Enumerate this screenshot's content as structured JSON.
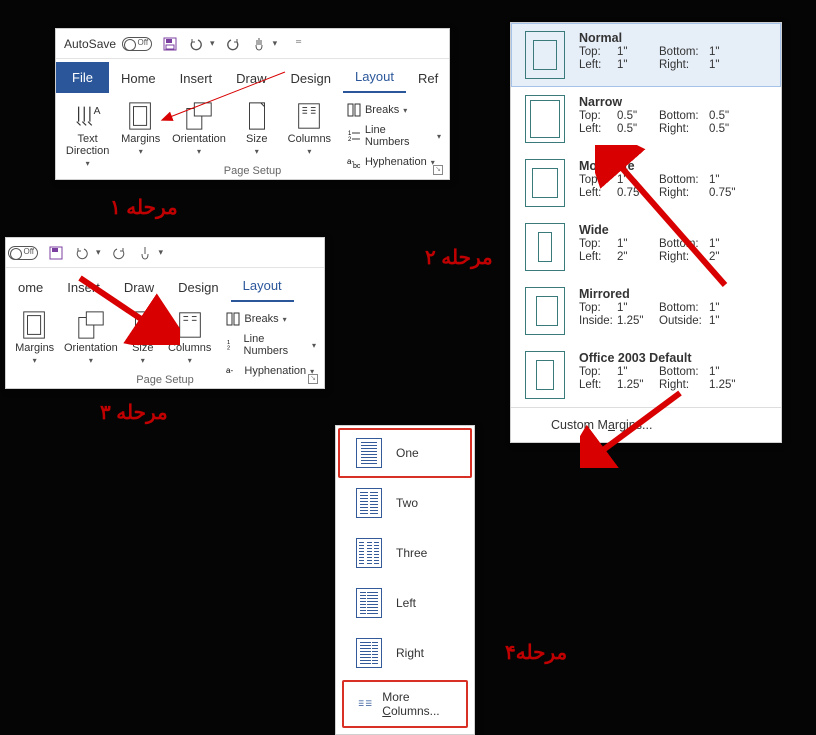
{
  "steps": {
    "s1": "مرحله ۱",
    "s2": "مرحله ۲",
    "s3": "مرحله ۳",
    "s4": "مرحله۴"
  },
  "title": {
    "autosave": "AutoSave"
  },
  "tabs": {
    "file": "File",
    "home": "Home",
    "insert": "Insert",
    "draw": "Draw",
    "design": "Design",
    "layout": "Layout",
    "ref": "Ref"
  },
  "ribbon": {
    "text_direction": "Text\nDirection",
    "margins": "Margins",
    "orientation": "Orientation",
    "size": "Size",
    "columns": "Columns",
    "breaks": "Breaks",
    "line_numbers": "Line Numbers",
    "hyphenation": "Hyphenation",
    "group": "Page Setup"
  },
  "tabs2": {
    "home": "ome",
    "insert": "Insert",
    "draw": "Draw",
    "design": "Design",
    "layout": "Layout"
  },
  "margins_menu": {
    "items": [
      {
        "name": "Normal",
        "k1": "Top:",
        "v1": "1\"",
        "k2": "Bottom:",
        "v2": "1\"",
        "k3": "Left:",
        "v3": "1\"",
        "k4": "Right:",
        "v4": "1\""
      },
      {
        "name": "Narrow",
        "k1": "Top:",
        "v1": "0.5\"",
        "k2": "Bottom:",
        "v2": "0.5\"",
        "k3": "Left:",
        "v3": "0.5\"",
        "k4": "Right:",
        "v4": "0.5\""
      },
      {
        "name": "Moderate",
        "k1": "Top:",
        "v1": "1\"",
        "k2": "Bottom:",
        "v2": "1\"",
        "k3": "Left:",
        "v3": "0.75",
        "k4": "Right:",
        "v4": "0.75\""
      },
      {
        "name": "Wide",
        "k1": "Top:",
        "v1": "1\"",
        "k2": "Bottom:",
        "v2": "1\"",
        "k3": "Left:",
        "v3": "2\"",
        "k4": "Right:",
        "v4": "2\""
      },
      {
        "name": "Mirrored",
        "k1": "Top:",
        "v1": "1\"",
        "k2": "Bottom:",
        "v2": "1\"",
        "k3": "Inside:",
        "v3": "1.25\"",
        "k4": "Outside:",
        "v4": "1\""
      },
      {
        "name": "Office 2003 Default",
        "k1": "Top:",
        "v1": "1\"",
        "k2": "Bottom:",
        "v2": "1\"",
        "k3": "Left:",
        "v3": "1.25\"",
        "k4": "Right:",
        "v4": "1.25\""
      }
    ],
    "custom": "Custom Margins..."
  },
  "columns_menu": {
    "one": "One",
    "two": "Two",
    "three": "Three",
    "left": "Left",
    "right": "Right",
    "more": "More Columns..."
  }
}
